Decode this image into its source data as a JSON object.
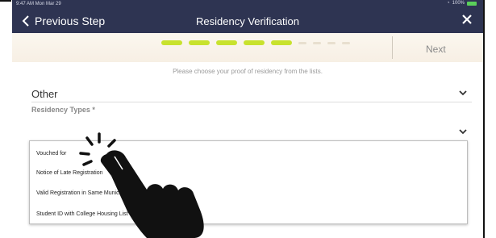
{
  "status": {
    "time": "9:47 AM  Mon Mar 29",
    "battery": "100%"
  },
  "nav": {
    "back_label": "Previous Step",
    "title": "Residency Verification"
  },
  "progress": {
    "completed_steps": 5,
    "total_steps": 9,
    "next_label": "Next"
  },
  "instruction": "Please choose your proof of residency from the lists.",
  "form": {
    "proof_category": "Other",
    "residency_types_label": "Residency Types *",
    "options": [
      "Vouched for",
      "Notice of Late Registration",
      "Valid Registration in Same Municipality",
      "Student ID with College Housing List"
    ]
  },
  "colors": {
    "header": "#2e3452",
    "progress_dot": "#c8e22e",
    "strip": "#fbf7ef"
  }
}
